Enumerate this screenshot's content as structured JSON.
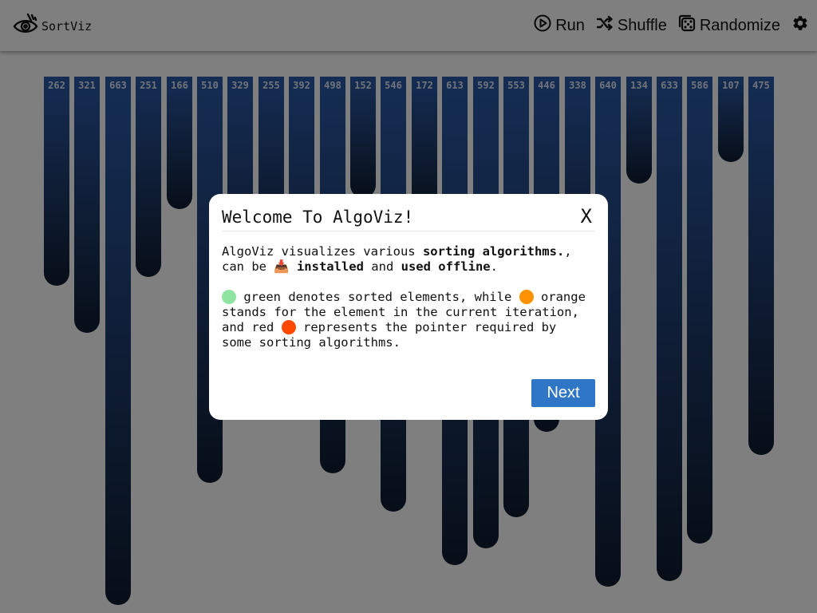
{
  "app": {
    "name": "SortViz"
  },
  "toolbar": {
    "run_label": "Run",
    "shuffle_label": "Shuffle",
    "randomize_label": "Randomize",
    "settings_icon": "gear-icon"
  },
  "bars": [
    262,
    321,
    663,
    251,
    166,
    510,
    329,
    255,
    392,
    498,
    152,
    546,
    172,
    613,
    592,
    553,
    446,
    338,
    640,
    134,
    633,
    586,
    107,
    475
  ],
  "modal": {
    "title": "Welcome To AlgoViz!",
    "close_label": "X",
    "p1_a": "AlgoViz visualizes various ",
    "p1_b": "sorting algorithms.",
    "p1_c": ", can be ",
    "p1_icon": "📥",
    "p1_d": " installed",
    "p1_e": " and ",
    "p1_f": "used offline",
    "p1_g": ".",
    "p2_a": " green denotes sorted elements, while ",
    "p2_b": " orange stands for the element in the current iteration, and red ",
    "p2_c": " represents the pointer required by some sorting algorithms.",
    "next_label": "Next"
  },
  "colors": {
    "sorted": "#8ee4a0",
    "current": "#ff9200",
    "pointer": "#ff4800",
    "accent": "#2f76c6"
  }
}
